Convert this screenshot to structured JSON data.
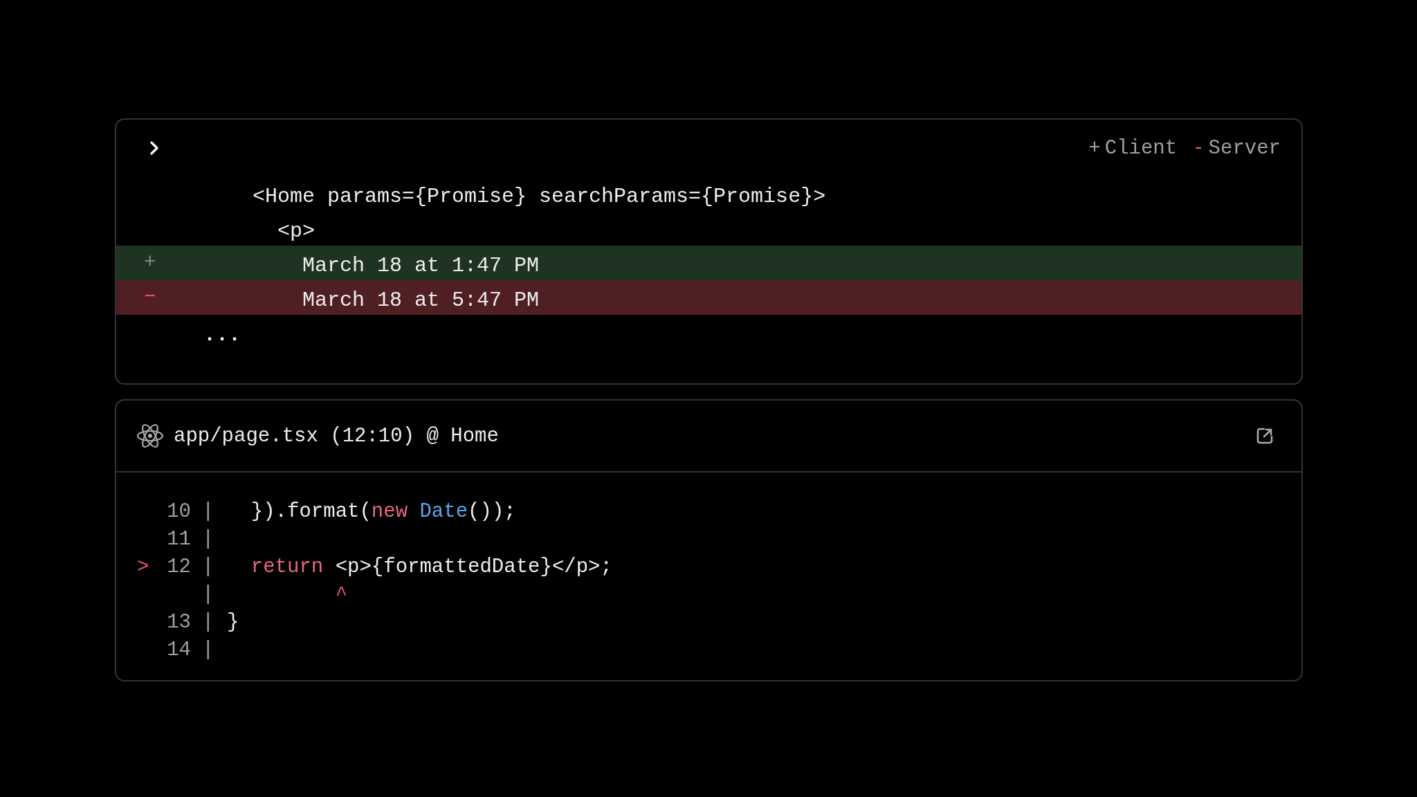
{
  "diff_panel": {
    "expanded": false,
    "legend": [
      {
        "kind": "added",
        "sign": "+",
        "label": "Client"
      },
      {
        "kind": "removed",
        "sign": "-",
        "label": "Server"
      }
    ],
    "lines": [
      {
        "kind": "context",
        "text": "<Home params={Promise} searchParams={Promise}>",
        "children": [
          {
            "kind": "context",
            "text": "<p>",
            "children": [
              {
                "kind": "added",
                "sign": "+",
                "text": "March 18 at 1:47 PM"
              },
              {
                "kind": "removed",
                "sign": "−",
                "text": "March 18 at 5:47 PM"
              }
            ]
          }
        ]
      },
      {
        "kind": "ellipsis",
        "text": "..."
      }
    ]
  },
  "source_panel": {
    "location": "app/page.tsx (12:10) @ Home",
    "lines": [
      {
        "number": "10",
        "gutter": "|",
        "tokens": [
          {
            "kind": "plain",
            "text": "  }).format("
          },
          {
            "kind": "keyword",
            "text": "new"
          },
          {
            "kind": "type",
            "text": " Date"
          },
          {
            "kind": "plain",
            "text": "());"
          }
        ]
      },
      {
        "number": "11",
        "gutter": "|"
      },
      {
        "number": "12",
        "marker": ">",
        "gutter": "|",
        "tokens": [
          {
            "kind": "keyword",
            "text": "  return"
          },
          {
            "kind": "plain",
            "text": " <p>{formattedDate}</p>;"
          }
        ]
      },
      {
        "gutter": "|",
        "caret": "         ^"
      },
      {
        "number": "13",
        "gutter": "|",
        "tokens": [
          {
            "kind": "plain",
            "text": "}"
          }
        ]
      },
      {
        "number": "14",
        "gutter": "|"
      }
    ]
  }
}
